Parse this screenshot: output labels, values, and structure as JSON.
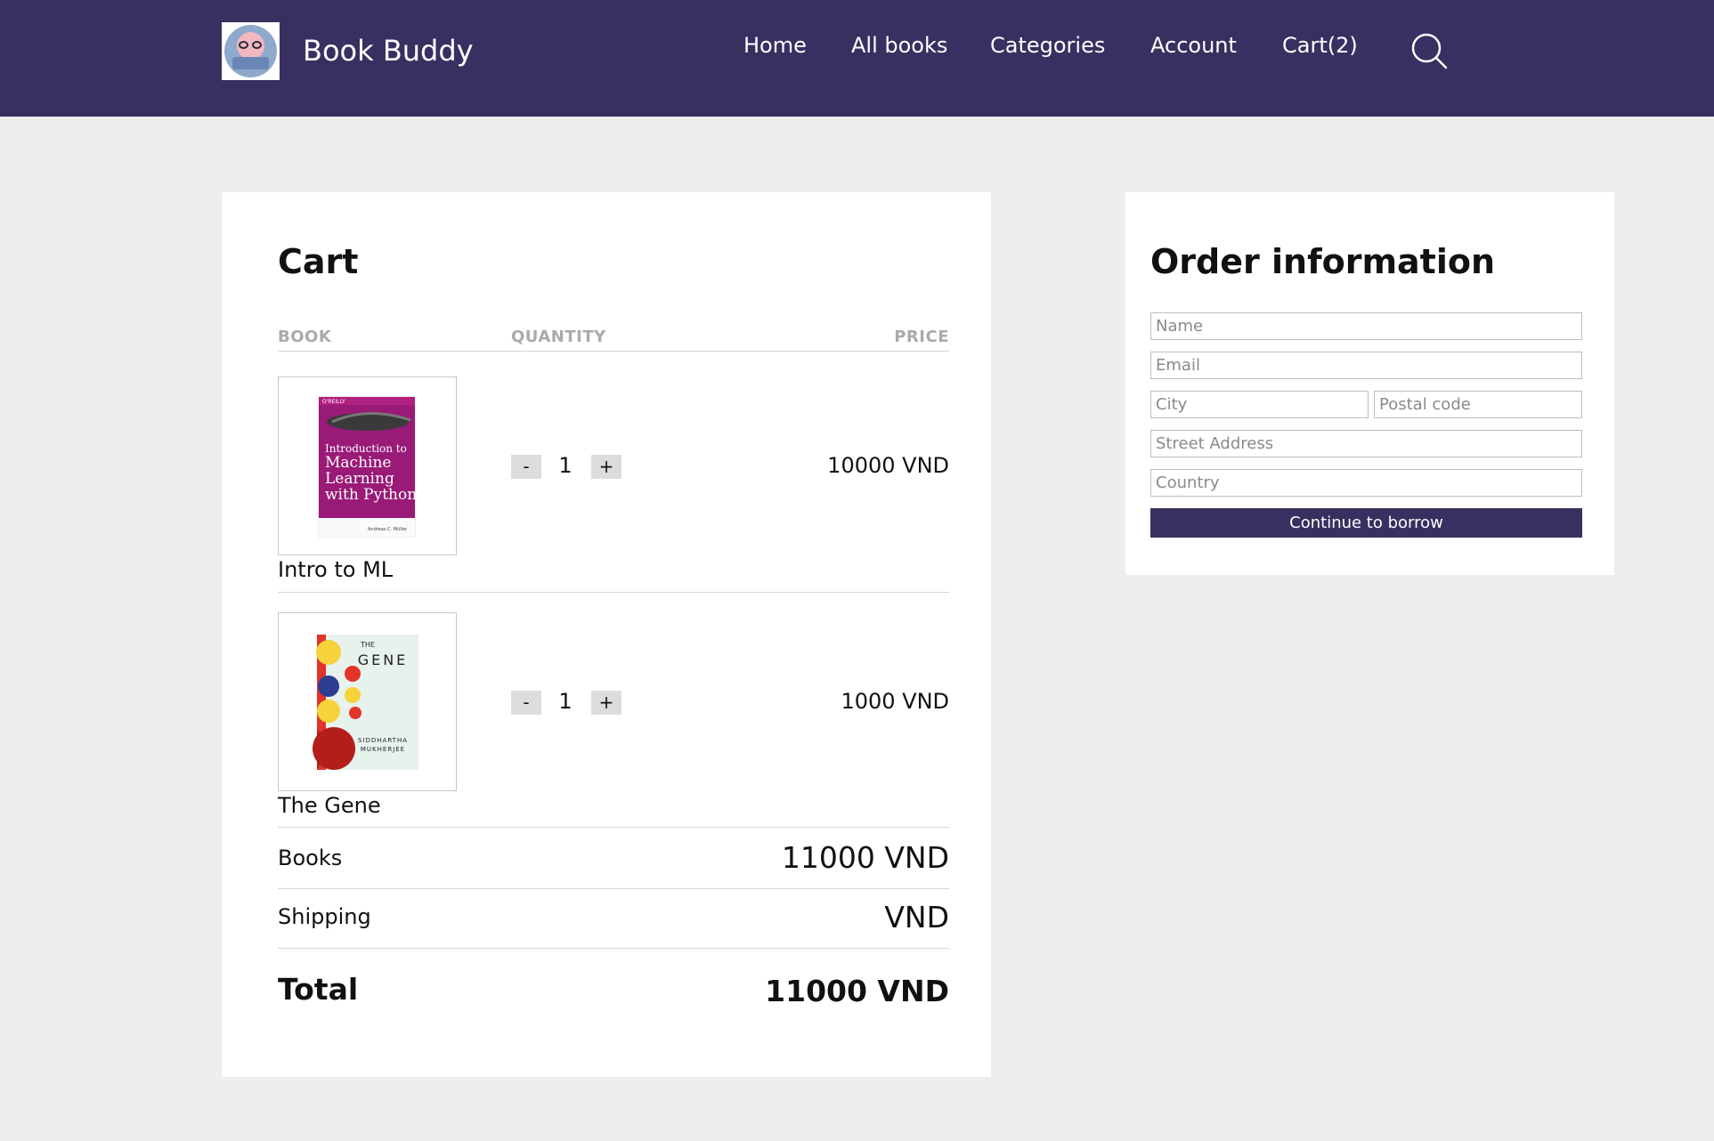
{
  "header": {
    "brand": "Book Buddy",
    "nav": [
      {
        "label": "Home"
      },
      {
        "label": "All books"
      },
      {
        "label": "Categories"
      },
      {
        "label": "Account"
      },
      {
        "label": "Cart(2)"
      }
    ],
    "search_icon": "search-icon",
    "bg_color": "#383060"
  },
  "cart": {
    "title": "Cart",
    "columns": {
      "book": "BOOK",
      "quantity": "QUANTITY",
      "price": "PRICE"
    },
    "items": [
      {
        "title": "Intro to ML",
        "quantity": "1",
        "price": "10000 VND",
        "decrement": "-",
        "increment": "+",
        "cover": {
          "text": "Introduction to Machine Learning with Python",
          "publisher": "O'REILLY",
          "color": "#9a1a78"
        }
      },
      {
        "title": "The Gene",
        "quantity": "1",
        "price": "1000 VND",
        "decrement": "-",
        "increment": "+",
        "cover": {
          "top": "THE",
          "title": "GENE",
          "author": "SIDDHARTHA MUKHERJEE"
        }
      }
    ],
    "summary": {
      "books_label": "Books",
      "books_value": "11000 VND",
      "shipping_label": "Shipping",
      "shipping_value": "VND",
      "total_label": "Total",
      "total_value": "11000 VND"
    }
  },
  "order": {
    "title": "Order information",
    "fields": {
      "name": "Name",
      "email": "Email",
      "city": "City",
      "postal": "Postal code",
      "street": "Street Address",
      "country": "Country"
    },
    "submit": "Continue to borrow"
  }
}
